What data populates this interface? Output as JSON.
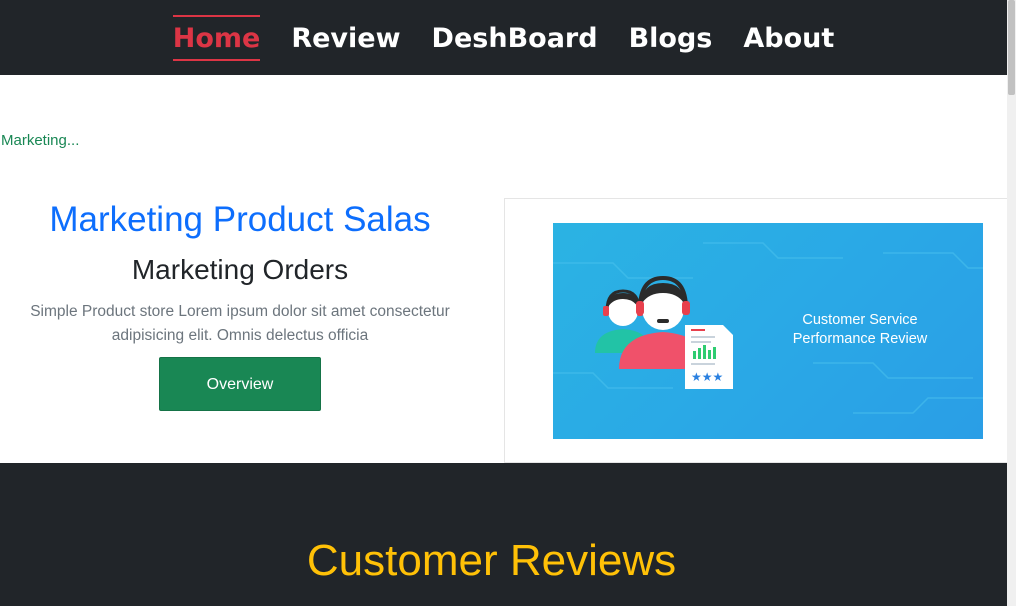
{
  "nav": {
    "items": [
      {
        "label": "Home",
        "active": true
      },
      {
        "label": "Review",
        "active": false
      },
      {
        "label": "DeshBoard",
        "active": false
      },
      {
        "label": "Blogs",
        "active": false
      },
      {
        "label": "About",
        "active": false
      }
    ]
  },
  "status": {
    "loading_text": "Marketing..."
  },
  "hero": {
    "title": "Marketing Product Salas",
    "subtitle": "Marketing Orders",
    "description": "Simple Product store Lorem ipsum dolor sit amet consectetur adipisicing elit. Omnis delectus officia",
    "button_label": "Overview",
    "image": {
      "caption_line1": "Customer Service",
      "caption_line2": "Performance Review",
      "icons": [
        "headset-agent-icon",
        "headset-agent-icon",
        "report-document-icon"
      ]
    }
  },
  "reviews": {
    "title": "Customer Reviews"
  },
  "colors": {
    "nav_bg": "#212529",
    "active_nav": "#dc3545",
    "title_blue": "#0d6efd",
    "button_green": "#198754",
    "reviews_title": "#ffc107",
    "image_bg": "#2aa8e6"
  }
}
